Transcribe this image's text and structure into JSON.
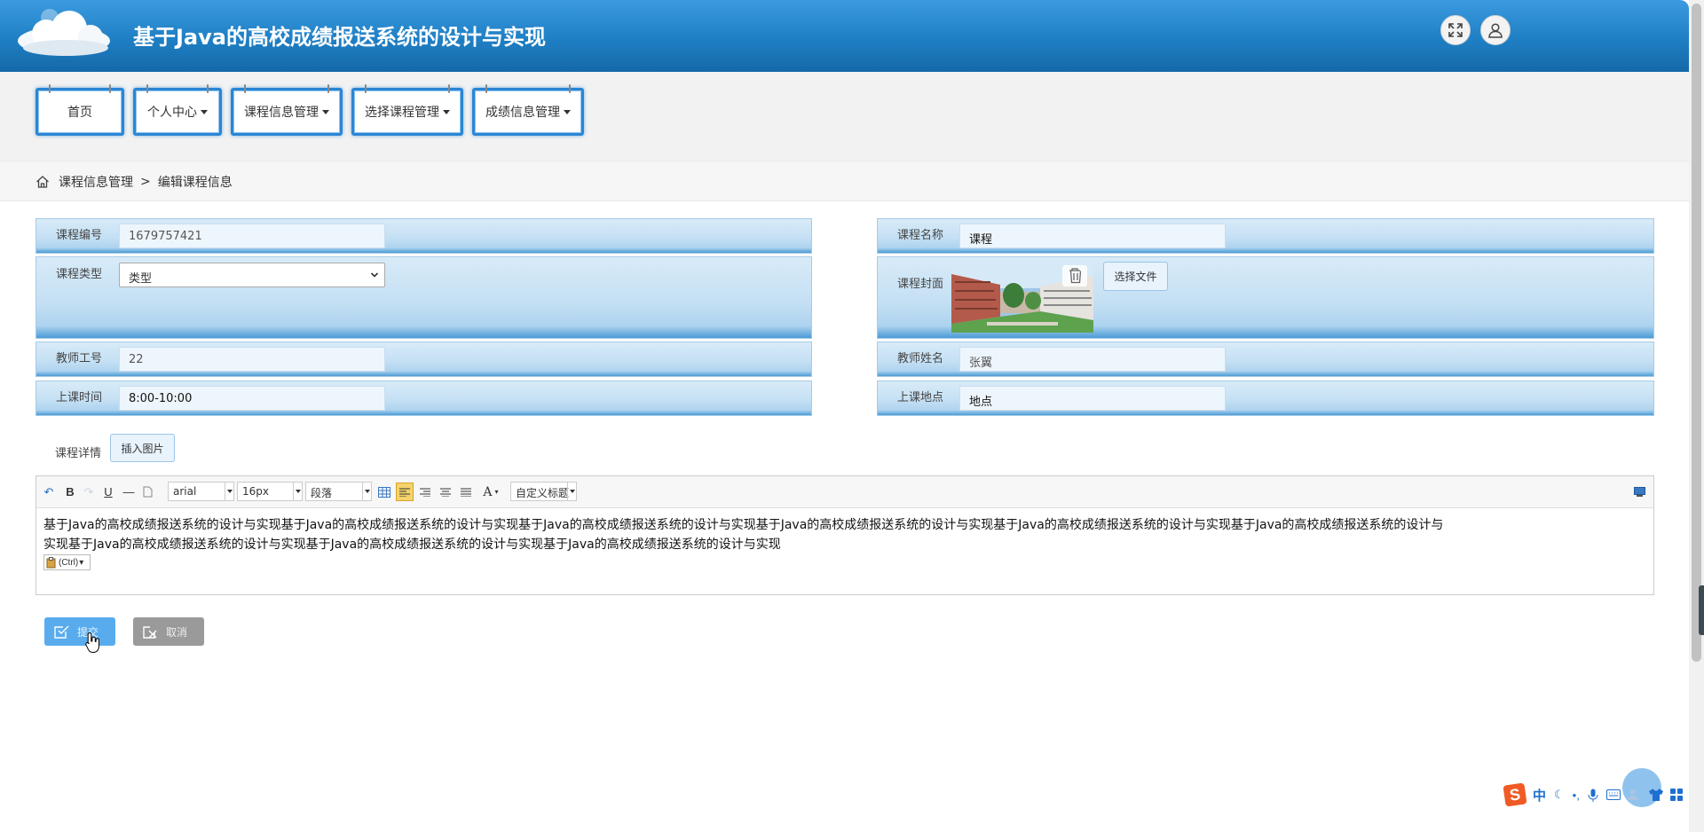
{
  "header": {
    "title": "基于Java的高校成绩报送系统的设计与实现"
  },
  "nav": {
    "items": [
      {
        "label": "首页",
        "dropdown": false
      },
      {
        "label": "个人中心",
        "dropdown": true
      },
      {
        "label": "课程信息管理",
        "dropdown": true
      },
      {
        "label": "选择课程管理",
        "dropdown": true
      },
      {
        "label": "成绩信息管理",
        "dropdown": true
      }
    ]
  },
  "breadcrumb": {
    "section": "课程信息管理",
    "separator": ">",
    "page": "编辑课程信息"
  },
  "form": {
    "course_no": {
      "label": "课程编号",
      "value": "1679757421"
    },
    "course_name": {
      "label": "课程名称",
      "value": "课程"
    },
    "course_type": {
      "label": "课程类型",
      "value": "类型"
    },
    "course_cover": {
      "label": "课程封面",
      "button": "选择文件"
    },
    "teacher_no": {
      "label": "教师工号",
      "value": "22"
    },
    "teacher_name": {
      "label": "教师姓名",
      "value": "张翼"
    },
    "class_time": {
      "label": "上课时间",
      "value": "8:00-10:00"
    },
    "class_place": {
      "label": "上课地点",
      "value": "地点"
    },
    "details": {
      "label": "课程详情",
      "insert_button": "插入图片"
    }
  },
  "editor": {
    "font": "arial",
    "size": "16px",
    "paragraph": "段落",
    "custom_heading": "自定义标题",
    "content_line1": "基于Java的高校成绩报送系统的设计与实现基于Java的高校成绩报送系统的设计与实现基于Java的高校成绩报送系统的设计与实现基于Java的高校成绩报送系统的设计与实现基于Java的高校成绩报送系统的设计与实现基于Java的高校成绩报送系统的设计与",
    "content_line2": "实现基于Java的高校成绩报送系统的设计与实现基于Java的高校成绩报送系统的设计与实现基于Java的高校成绩报送系统的设计与实现",
    "paste_hint": "(Ctrl)"
  },
  "actions": {
    "submit": "提交",
    "cancel": "取消"
  },
  "ime": {
    "lang": "中"
  },
  "colors": {
    "header": "#1f7fc4",
    "accent": "#2b86d4",
    "row": "#c5e0f4",
    "submit": "#58acee",
    "cancel": "#9a9a9a"
  }
}
